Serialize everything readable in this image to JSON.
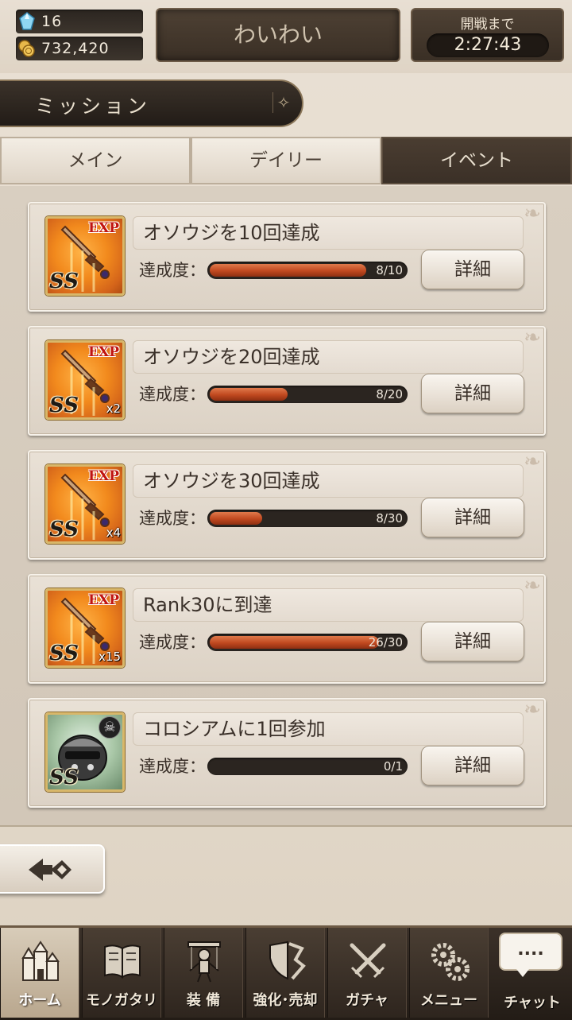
{
  "header": {
    "gems": "16",
    "gold": "732,420",
    "player_name": "わいわい",
    "timer_label": "開戦まで",
    "timer_value": "2:27:43"
  },
  "section": {
    "title": "ミッション"
  },
  "tabs": [
    {
      "label": "メイン",
      "active": false
    },
    {
      "label": "デイリー",
      "active": false
    },
    {
      "label": "イベント",
      "active": true
    }
  ],
  "missions": [
    {
      "title": "オソウジを10回達成",
      "progress_label": "達成度：",
      "current": 8,
      "target": 10,
      "progress_text": "8/10",
      "reward_badge": "EXP",
      "rarity": "SS",
      "quantity": "",
      "detail_label": "詳細"
    },
    {
      "title": "オソウジを20回達成",
      "progress_label": "達成度：",
      "current": 8,
      "target": 20,
      "progress_text": "8/20",
      "reward_badge": "EXP",
      "rarity": "SS",
      "quantity": "x2",
      "detail_label": "詳細"
    },
    {
      "title": "オソウジを30回達成",
      "progress_label": "達成度：",
      "current": 8,
      "target": 30,
      "progress_text": "8/30",
      "reward_badge": "EXP",
      "rarity": "SS",
      "quantity": "x4",
      "detail_label": "詳細"
    },
    {
      "title": "Rank30に到達",
      "progress_label": "達成度：",
      "current": 26,
      "target": 30,
      "progress_text": "26/30",
      "reward_badge": "EXP",
      "rarity": "SS",
      "quantity": "x15",
      "detail_label": "詳細"
    },
    {
      "title": "コロシアムに1回参加",
      "progress_label": "達成度：",
      "current": 0,
      "target": 1,
      "progress_text": "0/1",
      "reward_badge": "",
      "rarity": "SS",
      "quantity": "",
      "detail_label": "詳細"
    }
  ],
  "nav": [
    {
      "label": "ホーム",
      "icon": "castle-icon",
      "active": true
    },
    {
      "label": "モノガタリ",
      "icon": "book-icon",
      "active": false
    },
    {
      "label": "装 備",
      "icon": "puppet-icon",
      "active": false
    },
    {
      "label": "強化･売却",
      "icon": "shield-icon",
      "active": false
    },
    {
      "label": "ガチャ",
      "icon": "crossed-swords-icon",
      "active": false
    },
    {
      "label": "メニュー",
      "icon": "gears-icon",
      "active": false
    }
  ],
  "chat": {
    "bubble": "....",
    "label": "チャット"
  }
}
